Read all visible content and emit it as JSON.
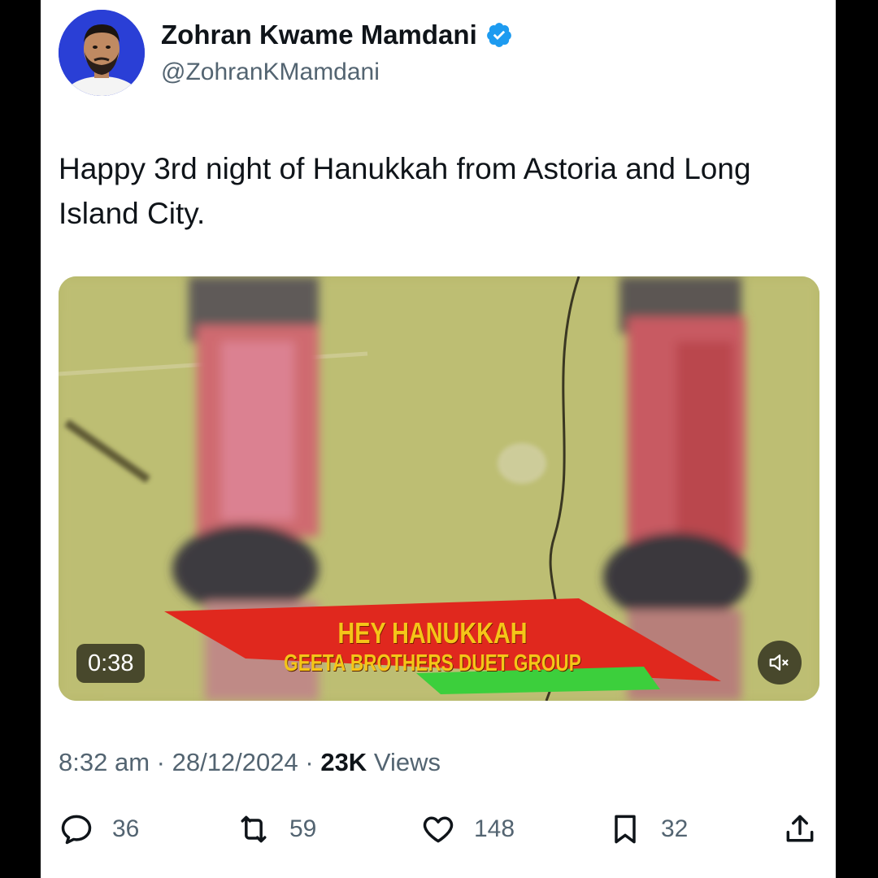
{
  "author": {
    "name": "Zohran Kwame Mamdani",
    "handle": "@ZohranKMamdani",
    "verified": true,
    "verified_color": "#1d9bf0",
    "avatar_bg": "#2a3fd6"
  },
  "tweet": {
    "text": "Happy 3rd night of Hanukkah from Astoria and Long Island City."
  },
  "media": {
    "type": "video",
    "duration": "0:38",
    "muted": true,
    "overlay_title": "HEY HANUKKAH",
    "overlay_subtitle": "GEETA BROTHERS DUET GROUP",
    "overlay_text_color": "#f5c518",
    "banner_red": "#e0281e",
    "banner_green": "#3ccf3c"
  },
  "meta": {
    "time": "8:32 am",
    "separator": "·",
    "date": "28/12/2024",
    "views_count": "23K",
    "views_label": "Views"
  },
  "actions": {
    "replies": "36",
    "reposts": "59",
    "likes": "148",
    "bookmarks": "32",
    "icons": [
      "reply-icon",
      "repost-icon",
      "like-icon",
      "bookmark-icon",
      "share-icon"
    ]
  }
}
